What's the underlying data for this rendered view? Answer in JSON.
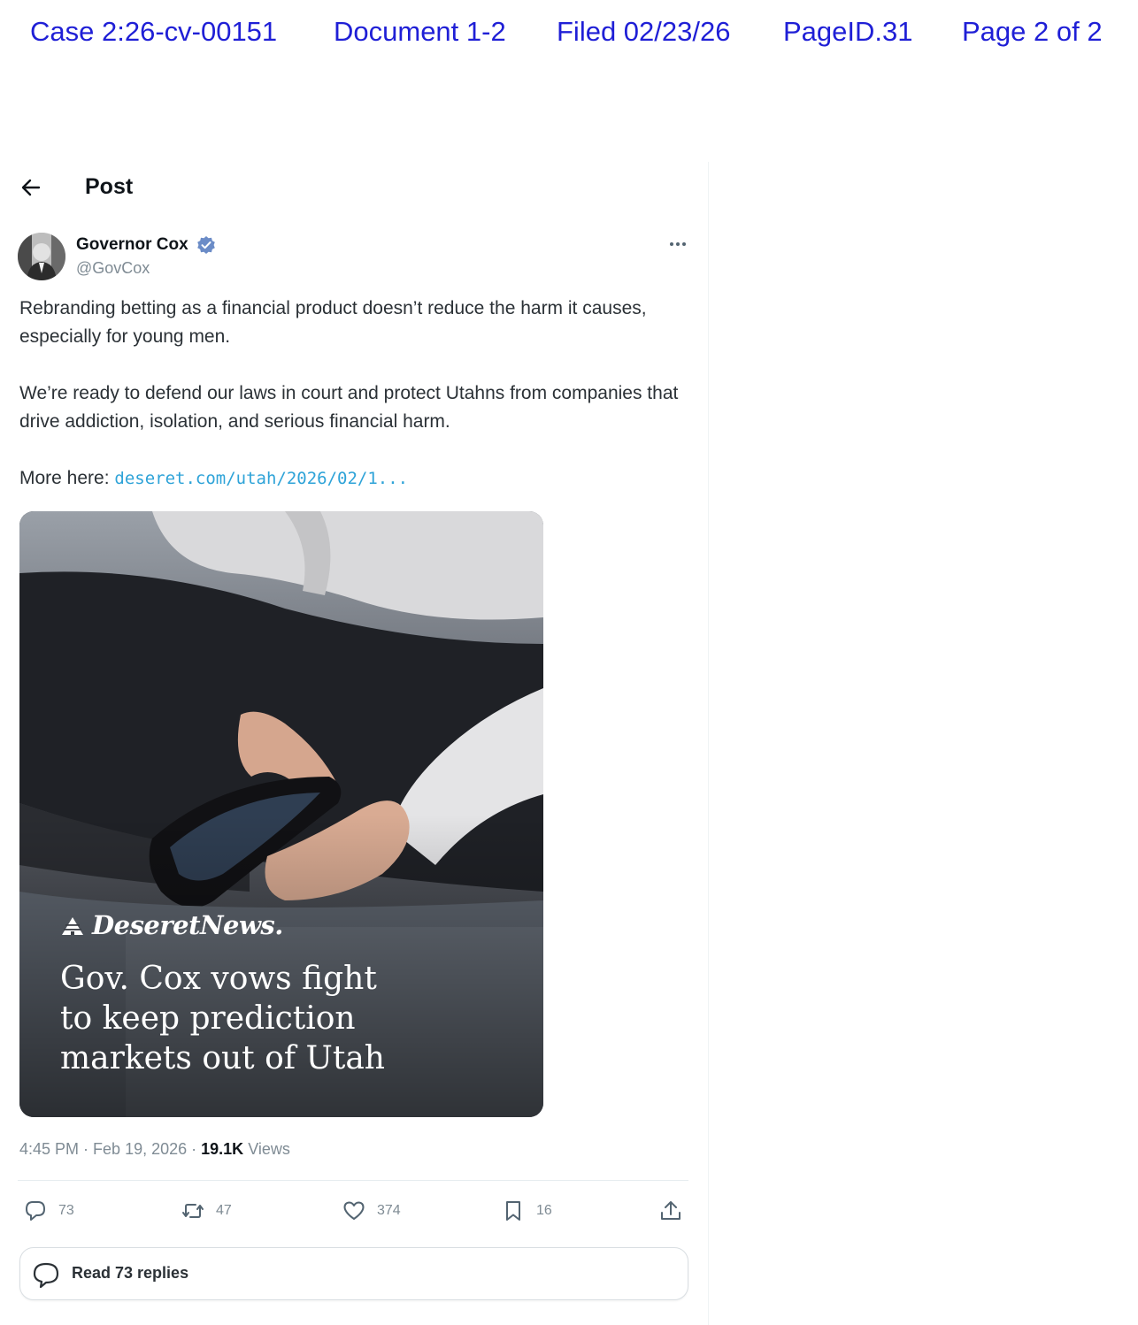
{
  "filing_header": {
    "case": "Case 2:26-cv-00151",
    "document": "Document 1-2",
    "filed": "Filed 02/23/26",
    "page_id": "PageID.31",
    "page": "Page 2 of 2",
    "color": "#1f1fd6"
  },
  "topbar": {
    "back_icon": "arrow-left-icon",
    "title": "Post"
  },
  "author": {
    "name": "Governor Cox",
    "handle": "@GovCox",
    "verified": true,
    "verified_color": "#6b8cc7",
    "more_icon": "ellipsis-icon"
  },
  "post": {
    "paragraph_1": "Rebranding betting as a financial product doesn’t reduce the harm it causes, especially for young men.",
    "paragraph_2": "We’re ready to defend our laws in court and protect Utahns from companies that drive addiction, isolation, and serious financial harm.",
    "more_prefix": "More here: ",
    "link_text": "deseret.com/utah/2026/02/1...",
    "link_color": "#2ea3d8"
  },
  "media": {
    "brand": "DeseretNews.",
    "brand_icon": "beehive-icon",
    "headline_line_1": "Gov. Cox vows fight",
    "headline_line_2": "to keep prediction",
    "headline_line_3": "markets out of Utah"
  },
  "meta": {
    "time": "4:45 PM",
    "separator": " · ",
    "date": "Feb 19, 2026",
    "views_count": "19.1K",
    "views_label": " Views"
  },
  "actions": {
    "replies": "73",
    "reposts": "47",
    "likes": "374",
    "bookmarks": "16",
    "icons": [
      "reply-icon",
      "repost-icon",
      "like-icon",
      "bookmark-icon",
      "share-icon"
    ]
  },
  "read_replies": {
    "label": "Read 73 replies",
    "icon": "chat-bubble-icon"
  }
}
